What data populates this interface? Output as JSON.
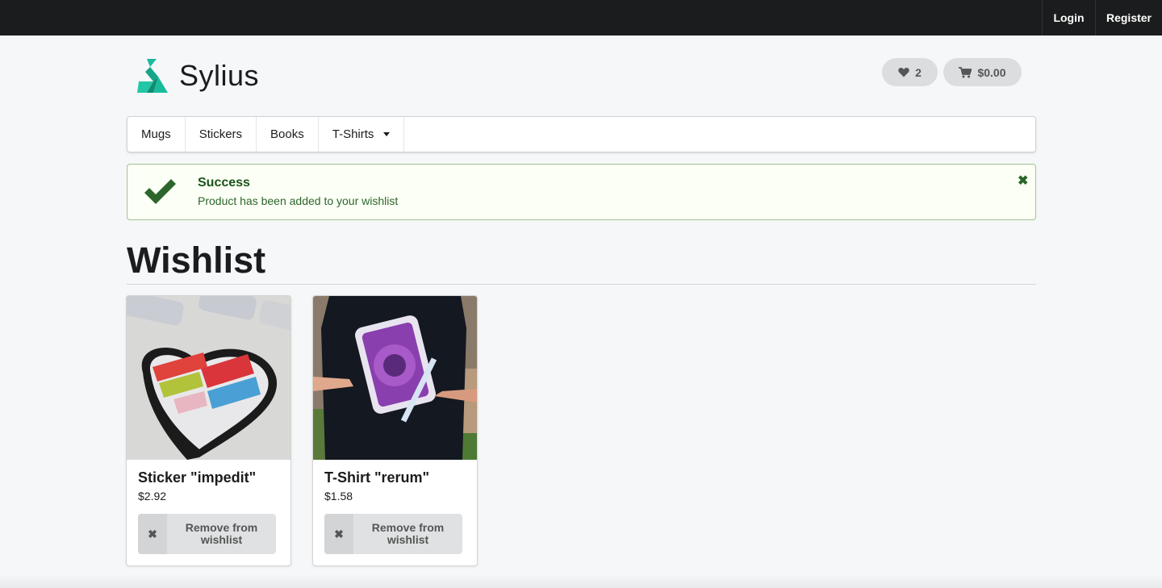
{
  "topbar": {
    "login": "Login",
    "register": "Register"
  },
  "brand": {
    "name": "Sylius",
    "accent": "#1abb9c"
  },
  "header": {
    "wishlist_count": "2",
    "cart_total": "$0.00"
  },
  "menu": {
    "items": [
      {
        "label": "Mugs"
      },
      {
        "label": "Stickers"
      },
      {
        "label": "Books"
      },
      {
        "label": "T-Shirts"
      }
    ]
  },
  "alert": {
    "title": "Success",
    "message": "Product has been added to your wishlist",
    "color": "#2c662d"
  },
  "page": {
    "title": "Wishlist"
  },
  "products": [
    {
      "name": "Sticker \"impedit\"",
      "price": "$2.92",
      "remove_label": "Remove from wishlist"
    },
    {
      "name": "T-Shirt \"rerum\"",
      "price": "$1.58",
      "remove_label": "Remove from wishlist"
    }
  ]
}
